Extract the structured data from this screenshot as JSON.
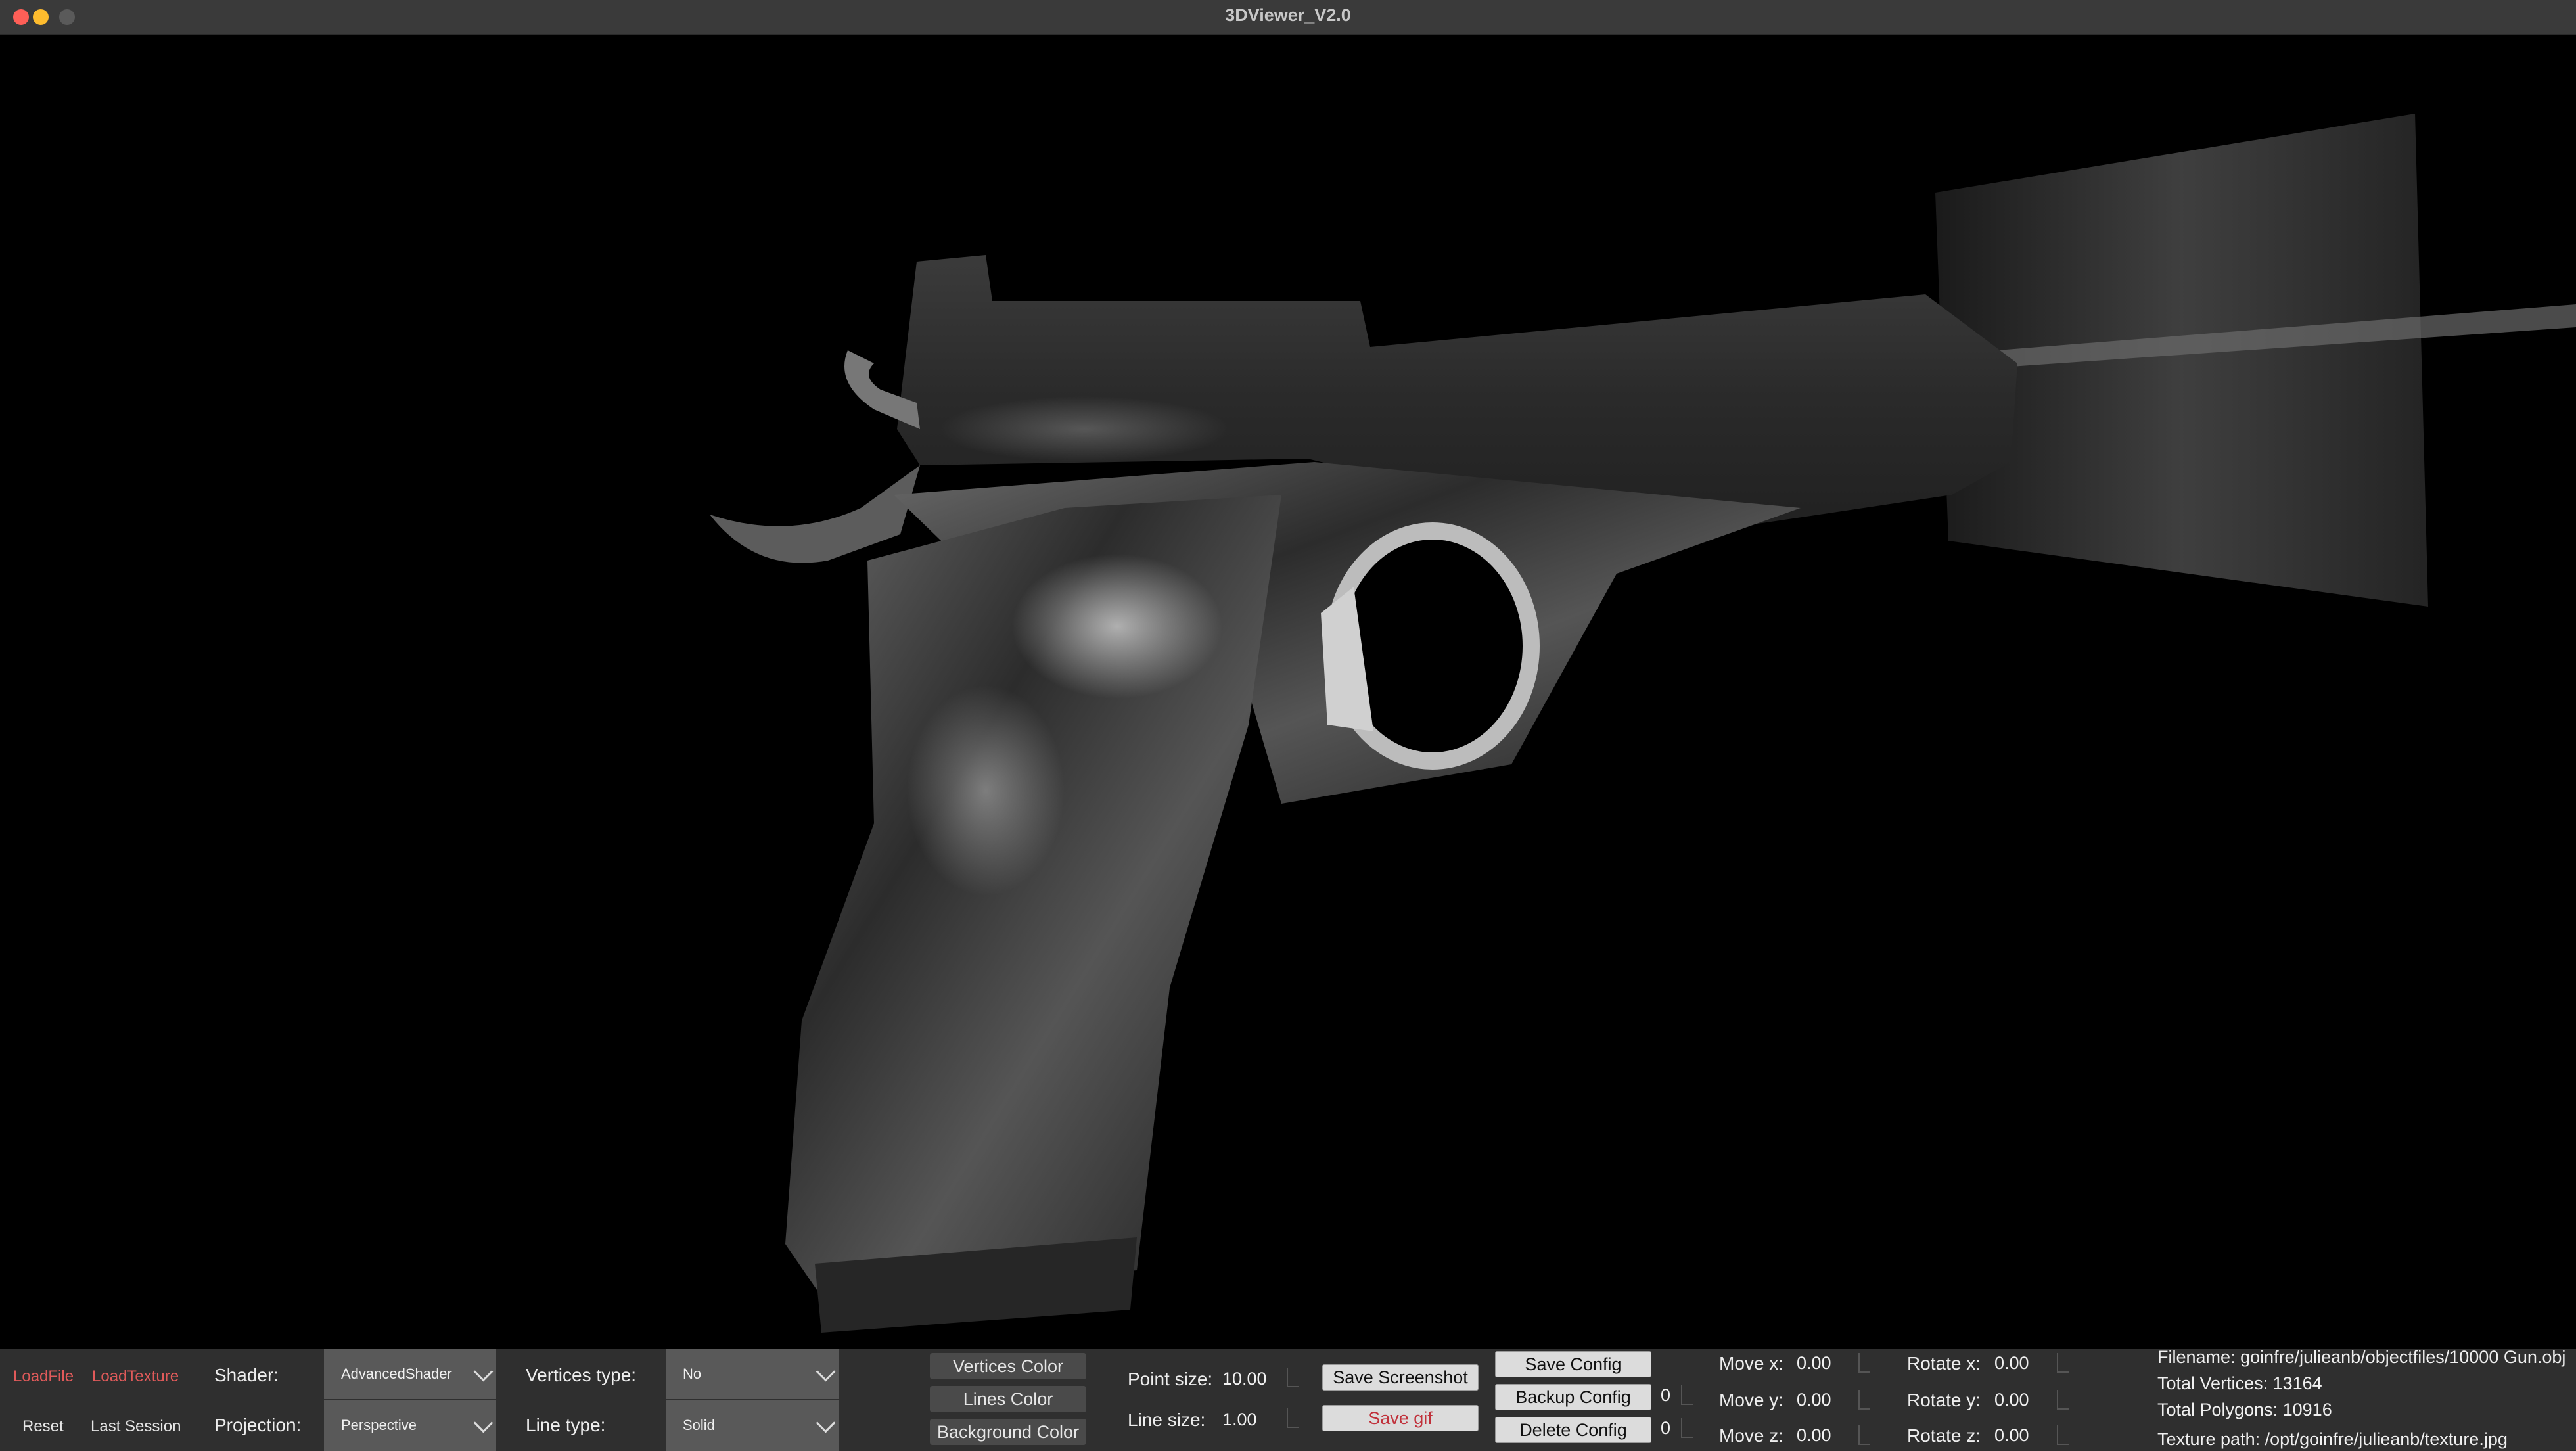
{
  "window": {
    "title": "3DViewer_V2.0"
  },
  "buttons": {
    "load_file": "LoadFile",
    "load_texture": "LoadTexture",
    "reset": "Reset",
    "last_session": "Last Session",
    "vertices_color": "Vertices Color",
    "lines_color": "Lines Color",
    "background_color": "Background Color",
    "save_screenshot": "Save Screenshot",
    "save_gif": "Save gif",
    "save_config": "Save Config",
    "backup_config": "Backup Config",
    "delete_config": "Delete Config"
  },
  "settings": {
    "shader_label": "Shader:",
    "shader_value": "AdvancedShader",
    "projection_label": "Projection:",
    "projection_value": "Perspective",
    "vertices_type_label": "Vertices type:",
    "vertices_type_value": "No",
    "line_type_label": "Line type:",
    "line_type_value": "Solid",
    "point_size_label": "Point size:",
    "point_size_value": "10.00",
    "line_size_label": "Line size:",
    "line_size_value": "1.00",
    "backup_count": "0",
    "delete_count": "0"
  },
  "transform": {
    "move_x_label": "Move x:",
    "move_x": "0.00",
    "move_y_label": "Move y:",
    "move_y": "0.00",
    "move_z_label": "Move z:",
    "move_z": "0.00",
    "rotate_x_label": "Rotate x:",
    "rotate_x": "0.00",
    "rotate_y_label": "Rotate y:",
    "rotate_y": "0.00",
    "rotate_z_label": "Rotate z:",
    "rotate_z": "0.00"
  },
  "info": {
    "filename_label": "Filename:",
    "filename": "goinfre/julieanb/objectfiles/10000 Gun.obj",
    "vertices_label": "Total Vertices:",
    "vertices": "13164",
    "polygons_label": "Total Polygons:",
    "polygons": "10916",
    "texture_label": "Texture path:",
    "texture": "/opt/goinfre/julieanb/texture.jpg"
  },
  "colors": {
    "panel_bg": "#2f2f2f",
    "accent_red": "#e05a5a",
    "viewport_bg": "#000000"
  }
}
